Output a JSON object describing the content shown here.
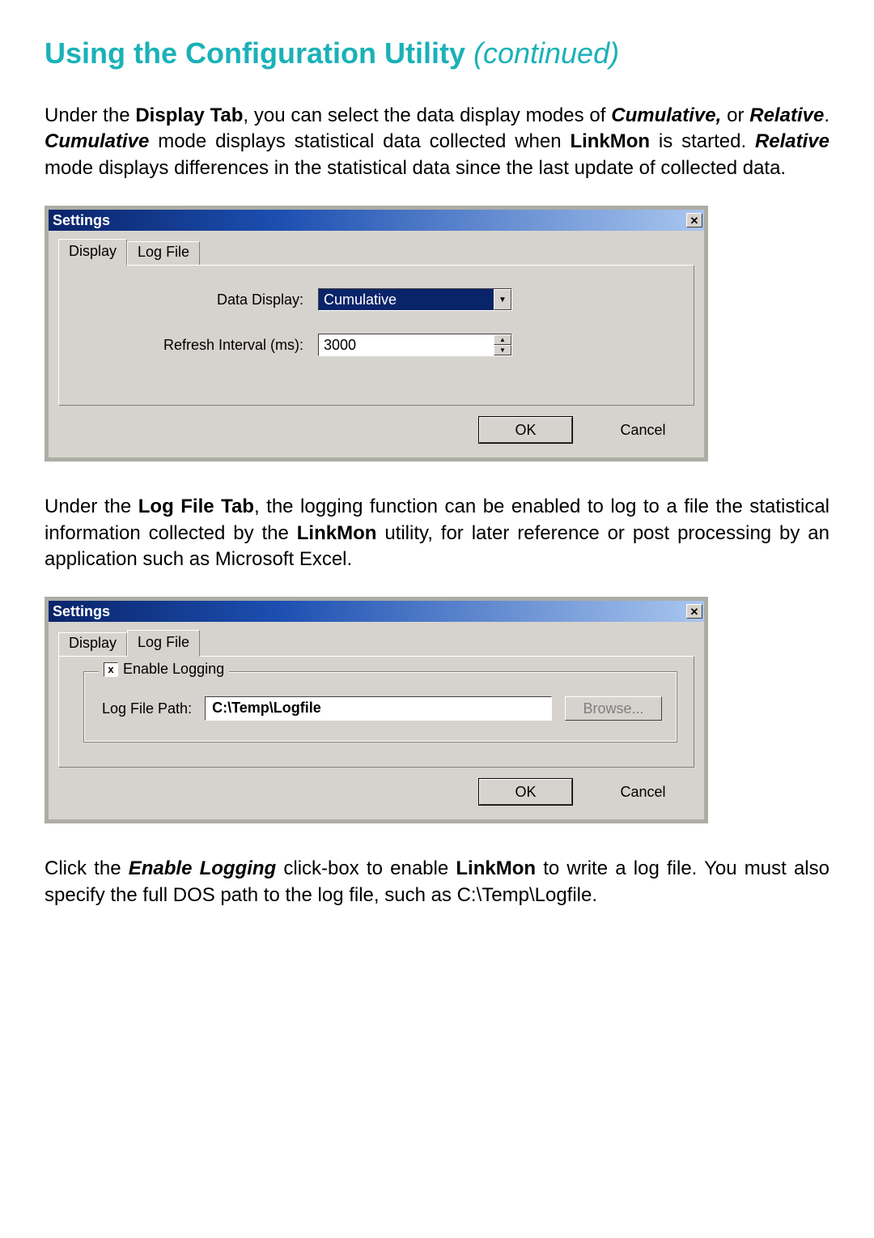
{
  "title": {
    "main": "Using the Configuration Utility ",
    "continued": "(continued)"
  },
  "para1": {
    "t1": "Under the ",
    "b1": "Display Tab",
    "t2": ", you can select the data display modes of ",
    "bi1": "Cumulative,",
    "t3": " or ",
    "bi2": "Relative",
    "t4": ".   ",
    "bi3": "Cumulative",
    "t5": " mode displays statistical data collected when ",
    "b2": "LinkMon",
    "t6": " is started.  ",
    "bi4": "Relative",
    "t7": " mode displays differences in the statistical data since the last update of collected data."
  },
  "dialog1": {
    "title": "Settings",
    "close_glyph": "✕",
    "tabs": {
      "display": "Display",
      "logfile": "Log File"
    },
    "labels": {
      "data_display": "Data Display:",
      "refresh": "Refresh Interval (ms):"
    },
    "values": {
      "data_display": "Cumulative",
      "refresh": "3000"
    },
    "buttons": {
      "ok": "OK",
      "cancel": "Cancel"
    },
    "glyphs": {
      "down": "▼",
      "up": "▲"
    }
  },
  "para2": {
    "t1": "Under the ",
    "b1": "Log File Tab",
    "t2": ", the logging function can be enabled to log to a file the statistical information collected by the ",
    "b2": "LinkMon",
    "t3": " utility, for later reference or post processing by an application such as Microsoft Excel."
  },
  "dialog2": {
    "title": "Settings",
    "close_glyph": "✕",
    "tabs": {
      "display": "Display",
      "logfile": "Log File"
    },
    "group": {
      "checkbox_mark": "x",
      "legend": "Enable Logging",
      "path_label": "Log File Path:",
      "path_value": "C:\\Temp\\Logfile",
      "browse": "Browse..."
    },
    "buttons": {
      "ok": "OK",
      "cancel": "Cancel"
    }
  },
  "para3": {
    "t1": "Click the ",
    "bi1": "Enable Logging",
    "t2": " click-box to enable ",
    "b1": "LinkMon",
    "t3": " to write a log file. You must also specify the full DOS path to the log file, such as C:\\Temp\\Logfile."
  }
}
